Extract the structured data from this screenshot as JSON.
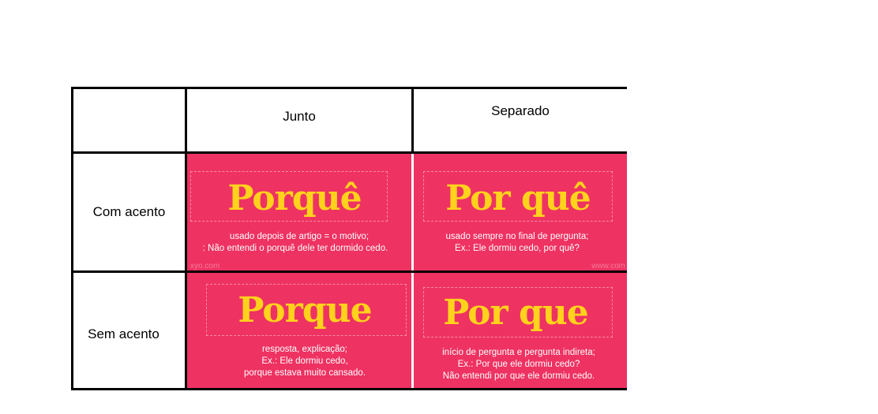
{
  "table": {
    "columns": [
      "Junto",
      "Separado"
    ],
    "rows": [
      "Com acento",
      "Sem acento"
    ],
    "cells": {
      "com_junto": {
        "word": "Porquê",
        "lines": [
          "usado depois de artigo = o motivo;",
          ": Não entendi o porquê dele ter dormido cedo."
        ],
        "watermark": "xyo.com"
      },
      "com_separado": {
        "word": "Por quê",
        "lines": [
          "usado sempre no final de pergunta;",
          "Ex.: Ele dormiu cedo, por quê?"
        ],
        "watermark": "www.com"
      },
      "sem_junto": {
        "word": "Porque",
        "lines": [
          "resposta, explicação;",
          "Ex.: Ele dormiu cedo,",
          "porque estava muito cansado."
        ]
      },
      "sem_separado": {
        "word": "Por que",
        "lines": [
          "início de pergunta e pergunta indireta;",
          "Ex.: Por que ele dormiu cedo?",
          "Não entendi por que ele dormiu cedo."
        ]
      }
    }
  },
  "colors": {
    "card_background": "#ee3262",
    "word_color": "#ffd21c",
    "border": "#000000"
  }
}
